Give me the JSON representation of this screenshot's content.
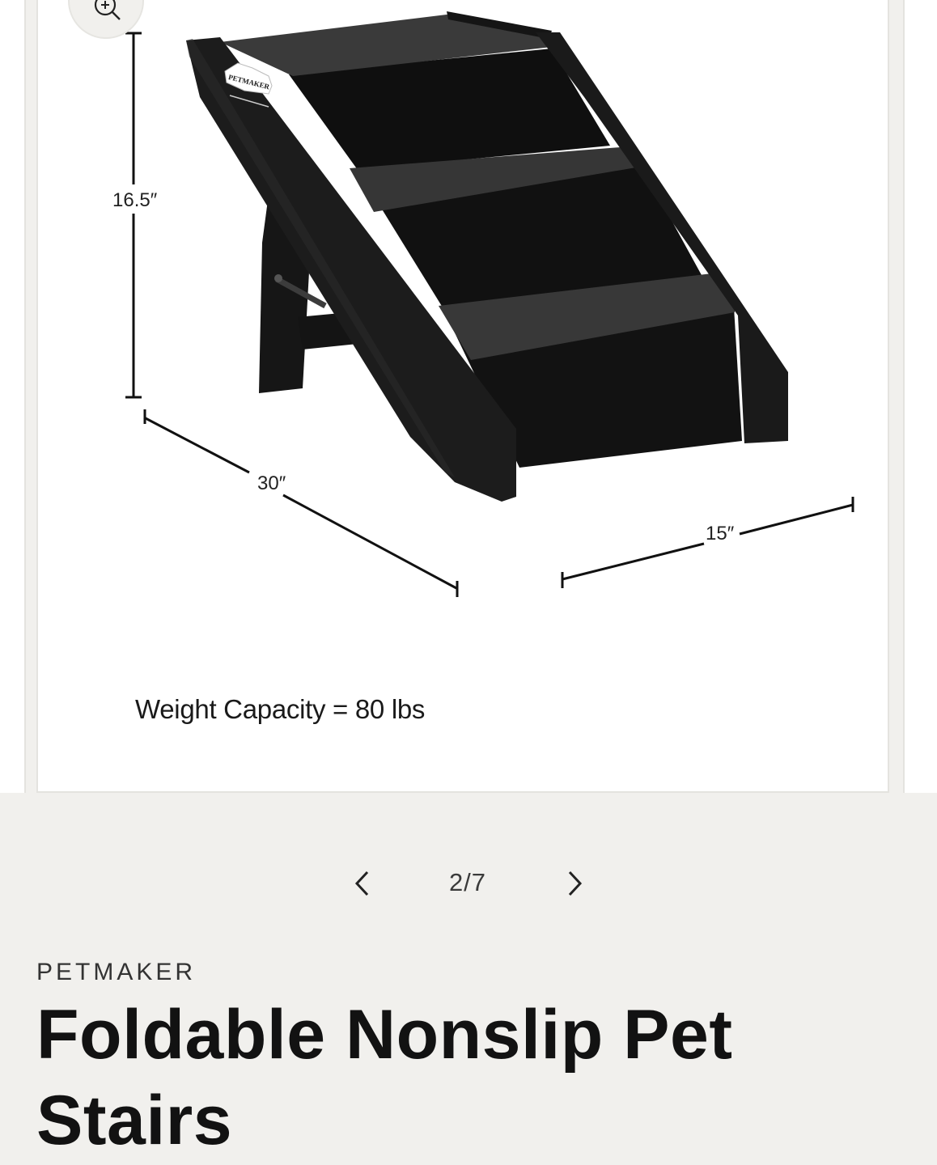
{
  "gallery": {
    "zoom_icon": "zoom-in-icon",
    "image": {
      "product": "pet-stairs-black",
      "logo_text": "PETMAKER",
      "height_label": "16.5″",
      "length_label": "30″",
      "width_label": "15″",
      "weight_text": "Weight Capacity = 80 lbs"
    }
  },
  "pager": {
    "prev_icon": "chevron-left-icon",
    "next_icon": "chevron-right-icon",
    "count": "2/7"
  },
  "product": {
    "brand": "PETMAKER",
    "title": "Foldable Nonslip Pet Stairs"
  },
  "colors": {
    "page_bg": "#f1f0ed",
    "slide_bg": "#ffffff",
    "stairs": "#1b1b1b",
    "tread": "#3a3a3a",
    "text": "#121212"
  }
}
